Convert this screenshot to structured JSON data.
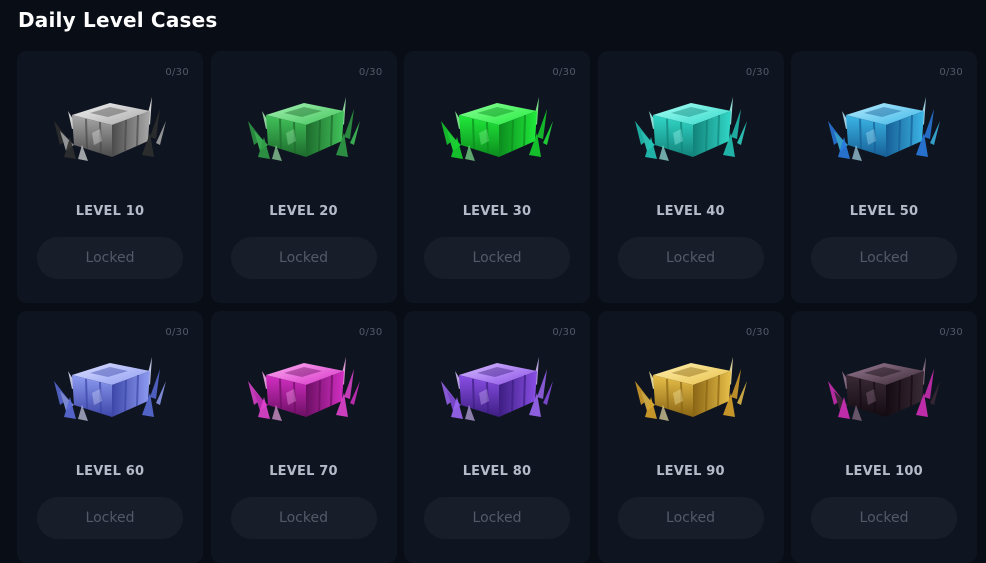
{
  "page": {
    "title": "Daily Level Cases"
  },
  "cases": [
    {
      "counter": "0/30",
      "level": "LEVEL 10",
      "button": "Locked",
      "icon": "level-10-case-icon",
      "colors": {
        "light": "#f2f2f2",
        "mid": "#a9a9a9",
        "dark": "#4b4b4b",
        "crystal": "#2f2f2f"
      }
    },
    {
      "counter": "0/30",
      "level": "LEVEL 20",
      "button": "Locked",
      "icon": "level-20-case-icon",
      "colors": {
        "light": "#a6f2b4",
        "mid": "#42c45b",
        "dark": "#1d6a2c",
        "crystal": "#2f9c46"
      }
    },
    {
      "counter": "0/30",
      "level": "LEVEL 30",
      "button": "Locked",
      "icon": "level-30-case-icon",
      "colors": {
        "light": "#8dff9a",
        "mid": "#20ea3b",
        "dark": "#0c8c1e",
        "crystal": "#16d22e"
      }
    },
    {
      "counter": "0/30",
      "level": "LEVEL 40",
      "button": "Locked",
      "icon": "level-40-case-icon",
      "colors": {
        "light": "#a9fff6",
        "mid": "#32d8c8",
        "dark": "#12837a",
        "crystal": "#22c4b6"
      }
    },
    {
      "counter": "0/30",
      "level": "LEVEL 50",
      "button": "Locked",
      "icon": "level-50-case-icon",
      "colors": {
        "light": "#b8ecff",
        "mid": "#3cb6e6",
        "dark": "#165f96",
        "crystal": "#2a7be0"
      }
    },
    {
      "counter": "0/30",
      "level": "LEVEL 60",
      "button": "Locked",
      "icon": "level-60-case-icon",
      "colors": {
        "light": "#dbe0ff",
        "mid": "#8f9cf2",
        "dark": "#3c47a8",
        "crystal": "#5a6bd8"
      }
    },
    {
      "counter": "0/30",
      "level": "LEVEL 70",
      "button": "Locked",
      "icon": "level-70-case-icon",
      "colors": {
        "light": "#ffb0f4",
        "mid": "#d42fc4",
        "dark": "#6b0f63",
        "crystal": "#e044cf"
      }
    },
    {
      "counter": "0/30",
      "level": "LEVEL 80",
      "button": "Locked",
      "icon": "level-80-case-icon",
      "colors": {
        "light": "#d6bcff",
        "mid": "#8a4fe6",
        "dark": "#3d1e82",
        "crystal": "#9b66f2"
      }
    },
    {
      "counter": "0/30",
      "level": "LEVEL 90",
      "button": "Locked",
      "icon": "level-90-case-icon",
      "colors": {
        "light": "#fff1b0",
        "mid": "#e8c04a",
        "dark": "#8a6514",
        "crystal": "#d9a32c"
      }
    },
    {
      "counter": "0/30",
      "level": "LEVEL 100",
      "button": "Locked",
      "icon": "level-100-case-icon",
      "colors": {
        "light": "#9a7b94",
        "mid": "#3a2a36",
        "dark": "#140b12",
        "crystal": "#d12fb8"
      }
    }
  ]
}
